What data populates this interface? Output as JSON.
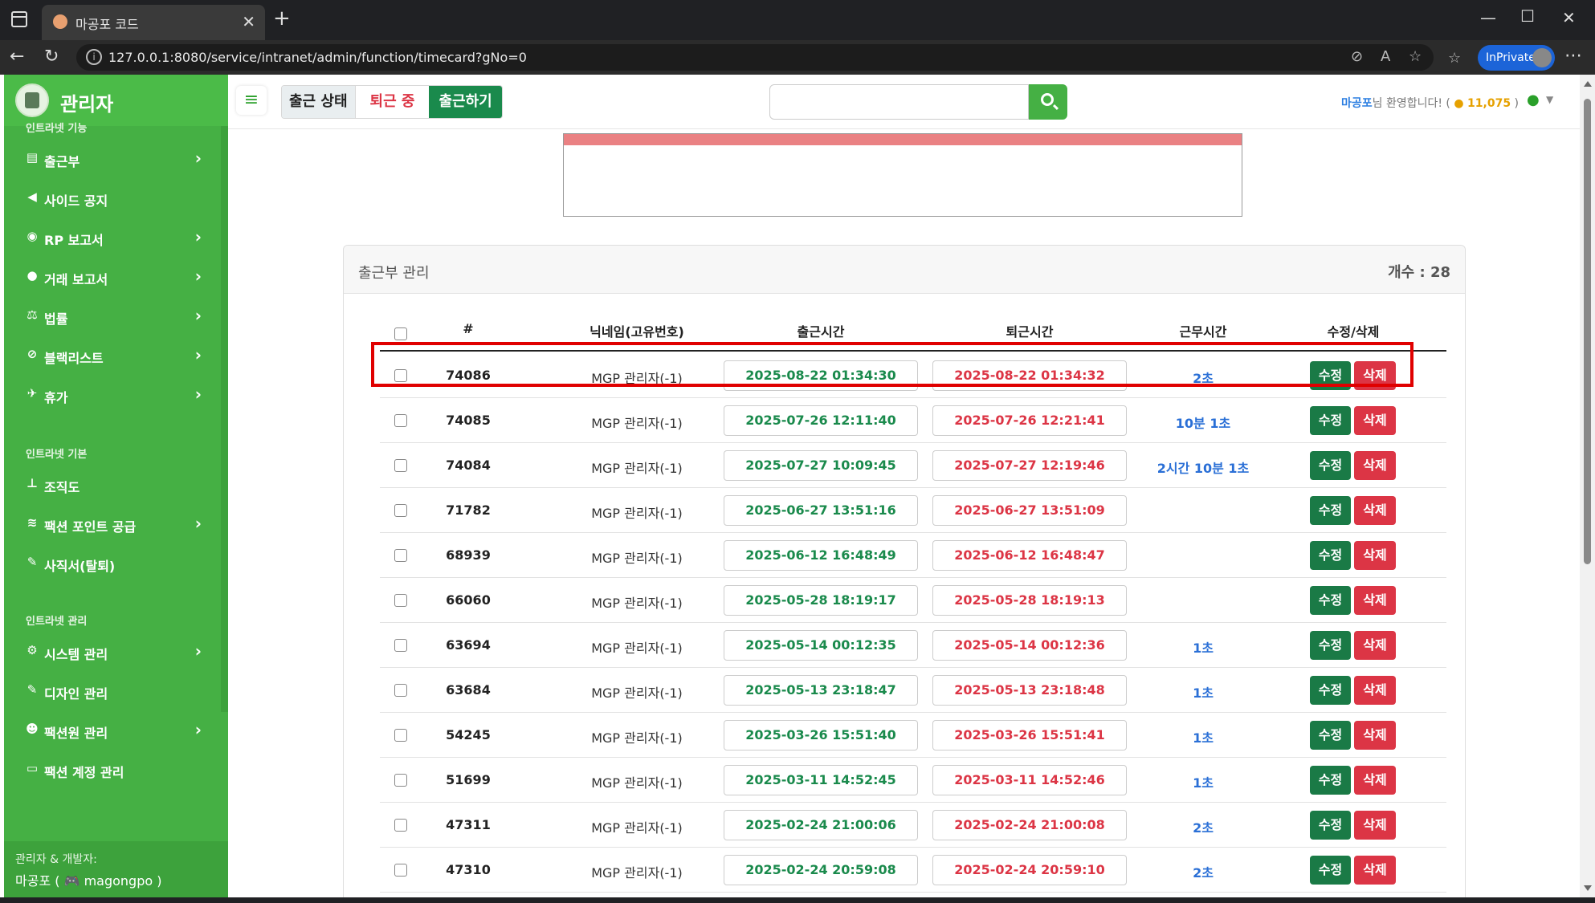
{
  "browser": {
    "tab_title": "마공포 코드",
    "url": "127.0.0.1:8080/service/intranet/admin/function/timecard?gNo=0",
    "inprivate_label": "InPrivate"
  },
  "sidebar": {
    "title": "관리자",
    "sections": [
      {
        "label": "인트라넷 기능",
        "items": [
          {
            "label": "출근부",
            "icon": "book-icon",
            "chevron": true
          },
          {
            "label": "사이드 공지",
            "icon": "megaphone-icon",
            "chevron": false
          },
          {
            "label": "RP 보고서",
            "icon": "gamepad-icon",
            "chevron": true
          },
          {
            "label": "거래 보고서",
            "icon": "moneybag-icon",
            "chevron": true
          },
          {
            "label": "법률",
            "icon": "scale-icon",
            "chevron": true
          },
          {
            "label": "블랙리스트",
            "icon": "ban-icon",
            "chevron": true
          },
          {
            "label": "휴가",
            "icon": "plane-icon",
            "chevron": true
          }
        ]
      },
      {
        "label": "인트라넷 기본",
        "items": [
          {
            "label": "조직도",
            "icon": "sitemap-icon",
            "chevron": false
          },
          {
            "label": "팩션 포인트 공급",
            "icon": "coins-icon",
            "chevron": true
          },
          {
            "label": "사직서(탈퇴)",
            "icon": "feather-icon",
            "chevron": false
          }
        ]
      },
      {
        "label": "인트라넷 관리",
        "items": [
          {
            "label": "시스템 관리",
            "icon": "gear-icon",
            "chevron": true
          },
          {
            "label": "디자인 관리",
            "icon": "brush-icon",
            "chevron": false
          },
          {
            "label": "팩션원 관리",
            "icon": "user-gear-icon",
            "chevron": true
          },
          {
            "label": "팩션 계정 관리",
            "icon": "id-card-icon",
            "chevron": false
          }
        ]
      }
    ],
    "footer_line1": "관리자 & 개발자:",
    "footer_line2": "마공포 ( 🎮 magongpo )"
  },
  "topbar": {
    "status_label": "출근 상태",
    "status_value": "퇴근 중",
    "checkin_button": "출근하기",
    "search_placeholder": "",
    "welcome_name": "마공포",
    "welcome_text": "님 환영합니다! (",
    "coin_amount": "11,075",
    "welcome_close": " )"
  },
  "card": {
    "title": "출근부 관리",
    "count_label": "개수 : 28",
    "headers": {
      "num": "#",
      "nick": "닉네임(고유번호)",
      "checkin": "출근시간",
      "checkout": "퇴근시간",
      "duration": "근무시간",
      "actions": "수정/삭제"
    },
    "edit_label": "수정",
    "delete_label": "삭제",
    "rows": [
      {
        "num": "74086",
        "nick": "MGP 관리자(-1)",
        "in": "2025-08-22 01:34:30",
        "out": "2025-08-22 01:34:32",
        "dur": "2초"
      },
      {
        "num": "74085",
        "nick": "MGP 관리자(-1)",
        "in": "2025-07-26 12:11:40",
        "out": "2025-07-26 12:21:41",
        "dur": "10분 1초"
      },
      {
        "num": "74084",
        "nick": "MGP 관리자(-1)",
        "in": "2025-07-27 10:09:45",
        "out": "2025-07-27 12:19:46",
        "dur": "2시간 10분 1초"
      },
      {
        "num": "71782",
        "nick": "MGP 관리자(-1)",
        "in": "2025-06-27 13:51:16",
        "out": "2025-06-27 13:51:09",
        "dur": ""
      },
      {
        "num": "68939",
        "nick": "MGP 관리자(-1)",
        "in": "2025-06-12 16:48:49",
        "out": "2025-06-12 16:48:47",
        "dur": ""
      },
      {
        "num": "66060",
        "nick": "MGP 관리자(-1)",
        "in": "2025-05-28 18:19:17",
        "out": "2025-05-28 18:19:13",
        "dur": ""
      },
      {
        "num": "63694",
        "nick": "MGP 관리자(-1)",
        "in": "2025-05-14 00:12:35",
        "out": "2025-05-14 00:12:36",
        "dur": "1초"
      },
      {
        "num": "63684",
        "nick": "MGP 관리자(-1)",
        "in": "2025-05-13 23:18:47",
        "out": "2025-05-13 23:18:48",
        "dur": "1초"
      },
      {
        "num": "54245",
        "nick": "MGP 관리자(-1)",
        "in": "2025-03-26 15:51:40",
        "out": "2025-03-26 15:51:41",
        "dur": "1초"
      },
      {
        "num": "51699",
        "nick": "MGP 관리자(-1)",
        "in": "2025-03-11 14:52:45",
        "out": "2025-03-11 14:52:46",
        "dur": "1초"
      },
      {
        "num": "47311",
        "nick": "MGP 관리자(-1)",
        "in": "2025-02-24 21:00:06",
        "out": "2025-02-24 21:00:08",
        "dur": "2초"
      },
      {
        "num": "47310",
        "nick": "MGP 관리자(-1)",
        "in": "2025-02-24 20:59:08",
        "out": "2025-02-24 20:59:10",
        "dur": "2초"
      }
    ]
  },
  "colors": {
    "sidebar": "#45b044",
    "accent_green": "#1a8a4c",
    "danger": "#dc3545",
    "duration_blue": "#2a6fd6",
    "highlight": "#e00000"
  }
}
